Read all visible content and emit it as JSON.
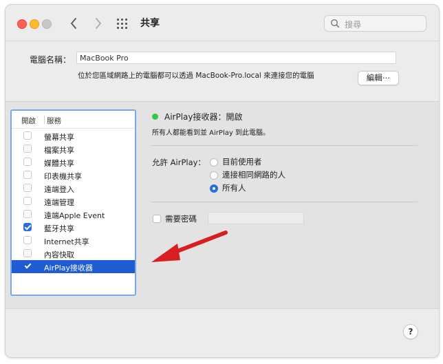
{
  "window": {
    "title": "共享"
  },
  "search": {
    "placeholder": "搜尋"
  },
  "computer_name": {
    "label": "電腦名稱：",
    "value": "MacBook Pro",
    "info": "位於您區域網路上的電腦都可以透過 MacBook-Pro.local 來連接您的電腦",
    "edit_button": "編輯⋯"
  },
  "services": {
    "header_enable": "開啟",
    "header_service": "服務",
    "items": [
      {
        "label": "螢幕共享",
        "checked": false,
        "selected": false
      },
      {
        "label": "檔案共享",
        "checked": false,
        "selected": false
      },
      {
        "label": "媒體共享",
        "checked": false,
        "selected": false
      },
      {
        "label": "印表機共享",
        "checked": false,
        "selected": false
      },
      {
        "label": "遠端登入",
        "checked": false,
        "selected": false
      },
      {
        "label": "遠端管理",
        "checked": false,
        "selected": false
      },
      {
        "label": "遠端Apple Event",
        "checked": false,
        "selected": false
      },
      {
        "label": "藍牙共享",
        "checked": true,
        "selected": false
      },
      {
        "label": "Internet共享",
        "checked": false,
        "selected": false
      },
      {
        "label": "內容快取",
        "checked": false,
        "selected": false
      },
      {
        "label": "AirPlay接收器",
        "checked": true,
        "selected": true
      }
    ]
  },
  "detail": {
    "status_label": "AirPlay接收器：開啟",
    "status_color": "#34c84a",
    "status_desc": "所有人都能看到並 AirPlay 到此電腦。",
    "allow_label": "允許 AirPlay：",
    "options": [
      {
        "label": "目前使用者",
        "selected": false
      },
      {
        "label": "連接相同網路的人",
        "selected": false
      },
      {
        "label": "所有人",
        "selected": true
      }
    ],
    "require_password_label": "需要密碼"
  },
  "help": {
    "label": "?"
  },
  "colors": {
    "accent": "#2a6ee0",
    "annotation_arrow": "#d81e1e"
  }
}
